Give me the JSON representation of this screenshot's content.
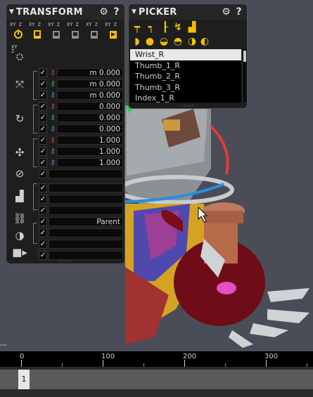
{
  "transform_panel": {
    "title": "TRANSFORM",
    "toolbar": [
      {
        "icon": "power-icon",
        "axes": "XY Z"
      },
      {
        "icon": "key-set-icon",
        "axes": "XY Z"
      },
      {
        "icon": "key-copy-icon",
        "axes": "XY Z"
      },
      {
        "icon": "key-paste-icon",
        "axes": "XY Z"
      },
      {
        "icon": "key-mirror-icon",
        "axes": "XY Z"
      },
      {
        "icon": "key-reset-icon",
        "axes": "XY Z"
      }
    ],
    "rows": [
      {
        "value": "m 0.000",
        "key_color": "#d23c3c"
      },
      {
        "value": "m 0.000",
        "key_color": "#35b24a"
      },
      {
        "value": "m 0.000",
        "key_color": "#3b8fd8"
      },
      {
        "value": "0.000",
        "key_color": "#d23c3c"
      },
      {
        "value": "0.000",
        "key_color": "#35b24a"
      },
      {
        "value": "0.000",
        "key_color": "#3b8fd8"
      },
      {
        "value": "1.000",
        "key_color": "#d23c3c"
      },
      {
        "value": "1.000",
        "key_color": "#35b24a"
      },
      {
        "value": "1.000",
        "key_color": "#3b8fd8"
      },
      {
        "value": ""
      },
      {
        "value": ""
      },
      {
        "value": ""
      },
      {
        "value": ""
      },
      {
        "value": "Parent"
      },
      {
        "value": ""
      },
      {
        "value": ""
      },
      {
        "value": ""
      }
    ],
    "groups": [
      "translate-icon",
      "rotate-icon",
      "scale-icon",
      "ik-icon",
      "foot-icon",
      "parent-link-icon",
      "blend-icon",
      "camera-icon"
    ],
    "grip": "....."
  },
  "picker_panel": {
    "title": "PICKER",
    "tools_row1": [
      "pin-a-icon",
      "pin-b-icon",
      "pin-c-icon",
      "snap-icon",
      "foot-pose-icon"
    ],
    "tools_row2": [
      "half-circle-icon",
      "full-circle-icon",
      "lower-half-icon",
      "half-dark-icon",
      "left-half-icon",
      "right-half-icon"
    ],
    "items": [
      "Wrist_R",
      "Thumb_1_R",
      "Thumb_2_R",
      "Thumb_3_R",
      "Index_1_R"
    ],
    "selected": "Wrist_R",
    "grip": "....."
  },
  "timeline": {
    "labels": [
      "0",
      "100",
      "200",
      "300"
    ],
    "current_frame": "1"
  },
  "colors": {
    "accent_yellow": "#f2c200",
    "key_red": "#d23c3c",
    "key_green": "#35b24a",
    "key_blue": "#3b8fd8"
  }
}
